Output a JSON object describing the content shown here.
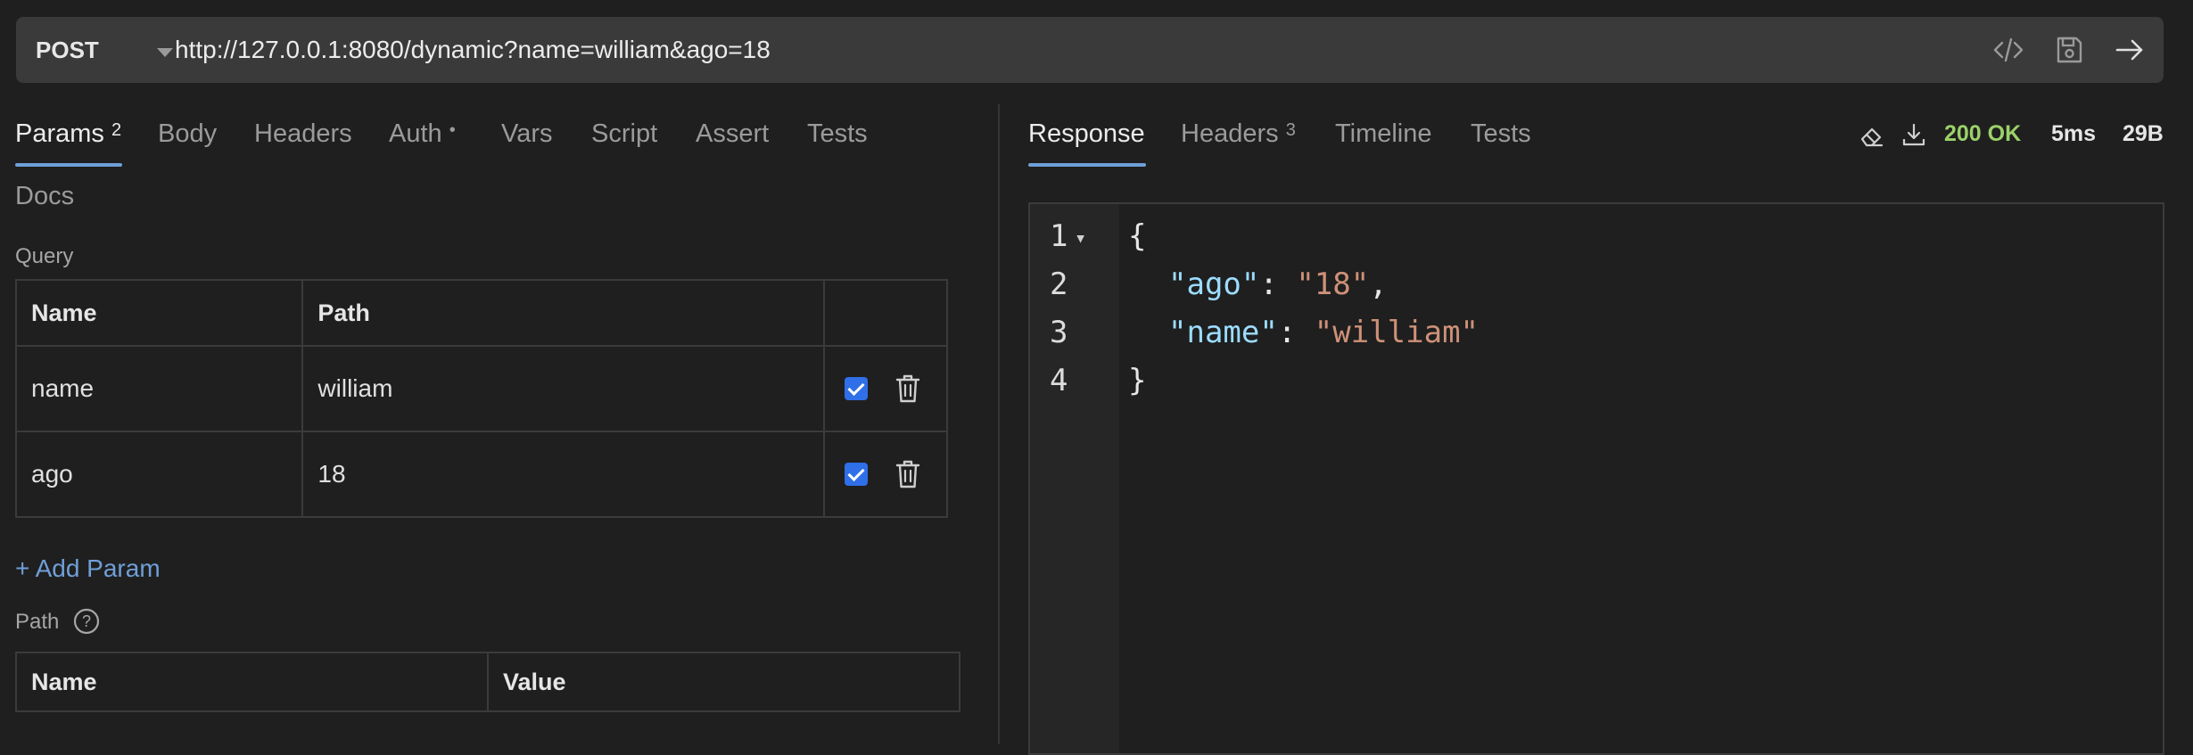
{
  "request": {
    "method": "POST",
    "url": "http://127.0.0.1:8080/dynamic?name=william&ago=18",
    "icons": [
      "code-icon",
      "save-icon",
      "send-arrow-icon"
    ]
  },
  "request_tabs": {
    "params_label": "Params",
    "params_count": "2",
    "body": "Body",
    "headers": "Headers",
    "auth": "Auth",
    "auth_dot": "•",
    "vars": "Vars",
    "script": "Script",
    "assert": "Assert",
    "tests": "Tests",
    "docs": "Docs"
  },
  "query": {
    "label": "Query",
    "columns": [
      "Name",
      "Path"
    ],
    "rows": [
      {
        "name": "name",
        "value": "william",
        "enabled": true
      },
      {
        "name": "ago",
        "value": "18",
        "enabled": true
      }
    ],
    "add_label": "+ Add Param"
  },
  "path_section": {
    "label": "Path",
    "help": "?",
    "columns": [
      "Name",
      "Value"
    ]
  },
  "response_tabs": {
    "response": "Response",
    "headers_label": "Headers",
    "headers_count": "3",
    "timeline": "Timeline",
    "tests": "Tests"
  },
  "response_meta": {
    "status": "200 OK",
    "time": "5ms",
    "size": "29B",
    "status_color": "#9bd16a"
  },
  "response_body": {
    "lines": [
      {
        "n": "1",
        "fold": "▾",
        "open": "{"
      },
      {
        "n": "2",
        "key": "\"ago\"",
        "sep": ": ",
        "val": "\"18\"",
        "comma": ","
      },
      {
        "n": "3",
        "key": "\"name\"",
        "sep": ": ",
        "val": "\"william\"",
        "comma": ""
      },
      {
        "n": "4",
        "close": "}"
      }
    ]
  }
}
